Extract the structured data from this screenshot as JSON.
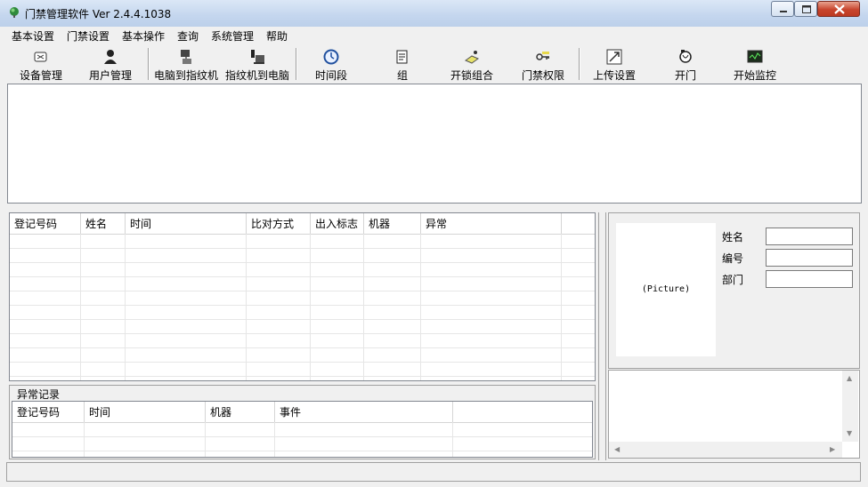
{
  "window": {
    "title": "门禁管理软件 Ver 2.4.4.1038"
  },
  "menu": [
    "基本设置",
    "门禁设置",
    "基本操作",
    "查询",
    "系统管理",
    "帮助"
  ],
  "toolbar": [
    {
      "label": "设备管理",
      "icon": "device-icon"
    },
    {
      "label": "用户管理",
      "icon": "user-icon"
    },
    {
      "label": "电脑到指纹机",
      "icon": "pc-to-device-icon"
    },
    {
      "label": "指纹机到电脑",
      "icon": "device-to-pc-icon"
    },
    {
      "label": "时间段",
      "icon": "clock-icon"
    },
    {
      "label": "组",
      "icon": "group-icon"
    },
    {
      "label": "开锁组合",
      "icon": "unlock-combo-icon"
    },
    {
      "label": "门禁权限",
      "icon": "key-icon"
    },
    {
      "label": "上传设置",
      "icon": "upload-icon"
    },
    {
      "label": "开门",
      "icon": "open-door-icon"
    },
    {
      "label": "开始监控",
      "icon": "monitor-icon"
    }
  ],
  "log_grid": {
    "columns": [
      "登记号码",
      "姓名",
      "时间",
      "比对方式",
      "出入标志",
      "机器",
      "异常"
    ]
  },
  "abnormal": {
    "title": "异常记录",
    "columns": [
      "登记号码",
      "时间",
      "机器",
      "事件"
    ]
  },
  "info": {
    "picture_placeholder": "(Picture)",
    "name_label": "姓名",
    "id_label": "编号",
    "dept_label": "部门",
    "name_value": "",
    "id_value": "",
    "dept_value": ""
  },
  "colors": {
    "titlebar": "#c4d6ee",
    "close_button": "#c8452d",
    "window_bg": "#f0f0f0"
  }
}
